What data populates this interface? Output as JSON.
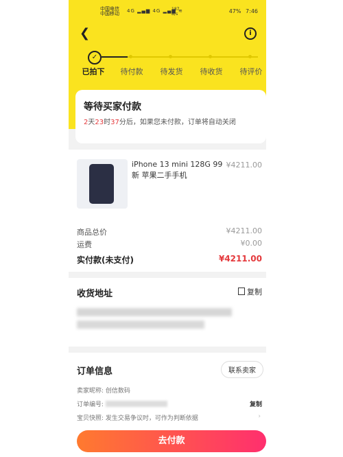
{
  "status_bar": {
    "carrier1": "中国电信",
    "carrier2": "中国移动",
    "signal": "4G ▂▄▆ 4G ▂▄▆  ≋",
    "net_speed": "187 B/s",
    "battery": "47%",
    "time": "7:46"
  },
  "steps": [
    {
      "label": "已拍下"
    },
    {
      "label": "待付款"
    },
    {
      "label": "待发货"
    },
    {
      "label": "待收货"
    },
    {
      "label": "待评价"
    }
  ],
  "wait_card": {
    "title": "等待买家付款",
    "days": "2",
    "days_unit": "天",
    "hours": "23",
    "hours_unit": "时",
    "minutes": "37",
    "desc_rest": "分后，如果您未付款，订单将自动关闭"
  },
  "product": {
    "title": "iPhone 13 mini 128G 99新 苹果二手手机",
    "price": "¥4211.00"
  },
  "summary": {
    "goods_total_label": "商品总价",
    "goods_total_value": "¥4211.00",
    "shipping_label": "运费",
    "shipping_value": "¥0.00",
    "paid_label": "实付款(未支付)",
    "paid_value": "¥4211.00"
  },
  "address": {
    "title": "收货地址",
    "copy_label": "复制"
  },
  "order_info": {
    "title": "订单信息",
    "contact_label": "联系卖家",
    "seller_nick": "卖家昵称: 创信数码",
    "order_no_label": "订单编号:",
    "order_copy": "复制",
    "snapshot": "宝贝快照: 发生交易争议时，可作为判断依据"
  },
  "pay_button": "去付款",
  "colors": {
    "brand_yellow": "#fae31f",
    "price_red": "#e4393c"
  }
}
